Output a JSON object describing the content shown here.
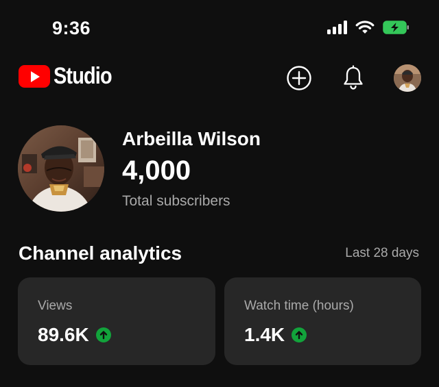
{
  "status_bar": {
    "time": "9:36"
  },
  "app": {
    "brand": "Studio",
    "icons": {
      "create": "plus-circle-icon",
      "notifications": "bell-icon",
      "account": "avatar"
    }
  },
  "channel": {
    "name": "Arbeilla Wilson",
    "subscribers": "4,000",
    "subscribers_label": "Total subscribers"
  },
  "analytics": {
    "title": "Channel analytics",
    "period": "Last 28 days",
    "cards": [
      {
        "label": "Views",
        "value": "89.6K",
        "trend": "up"
      },
      {
        "label": "Watch time (hours)",
        "value": "1.4K",
        "trend": "up"
      }
    ]
  },
  "colors": {
    "background": "#0f0f0f",
    "card": "#272727",
    "brand_red": "#ff0000",
    "trend_up": "#12a33b",
    "secondary_text": "#aaaaaa"
  }
}
